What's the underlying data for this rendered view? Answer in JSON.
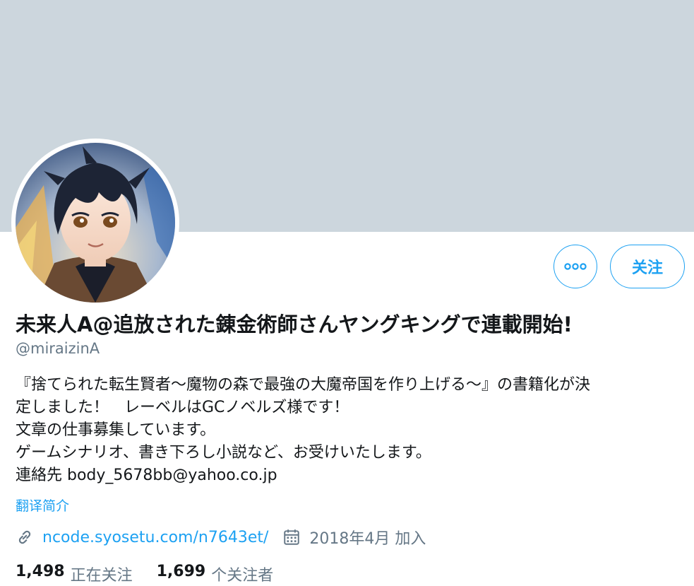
{
  "profile": {
    "display_name": "未来人A@追放された錬金術師さんヤングキングで連載開始!",
    "handle": "@miraizinA",
    "bio_lines": [
      "『捨てられた転生賢者～魔物の森で最強の大魔帝国を作り上げる～』の書籍化が決",
      "定しました！　レーベルはGCノベルズ様です！",
      "文章の仕事募集しています。",
      "ゲームシナリオ、書き下ろし小説など、お受けいたします。",
      "連絡先 body_5678bb@yahoo.co.jp"
    ],
    "translate_label": "翻译简介",
    "website": "ncode.syosetu.com/n7643et/",
    "joined": "2018年4月 加入"
  },
  "actions": {
    "more_icon": "more-dots-icon",
    "follow_label": "关注"
  },
  "stats": {
    "following_count": "1,498",
    "following_label": "正在关注",
    "followers_count": "1,699",
    "followers_label": "个关注者"
  },
  "icons": {
    "link": "link-icon",
    "calendar": "calendar-icon"
  },
  "colors": {
    "accent": "#1da1f2",
    "banner": "#ccd6dd",
    "secondary_text": "#657786",
    "primary_text": "#14171a"
  }
}
